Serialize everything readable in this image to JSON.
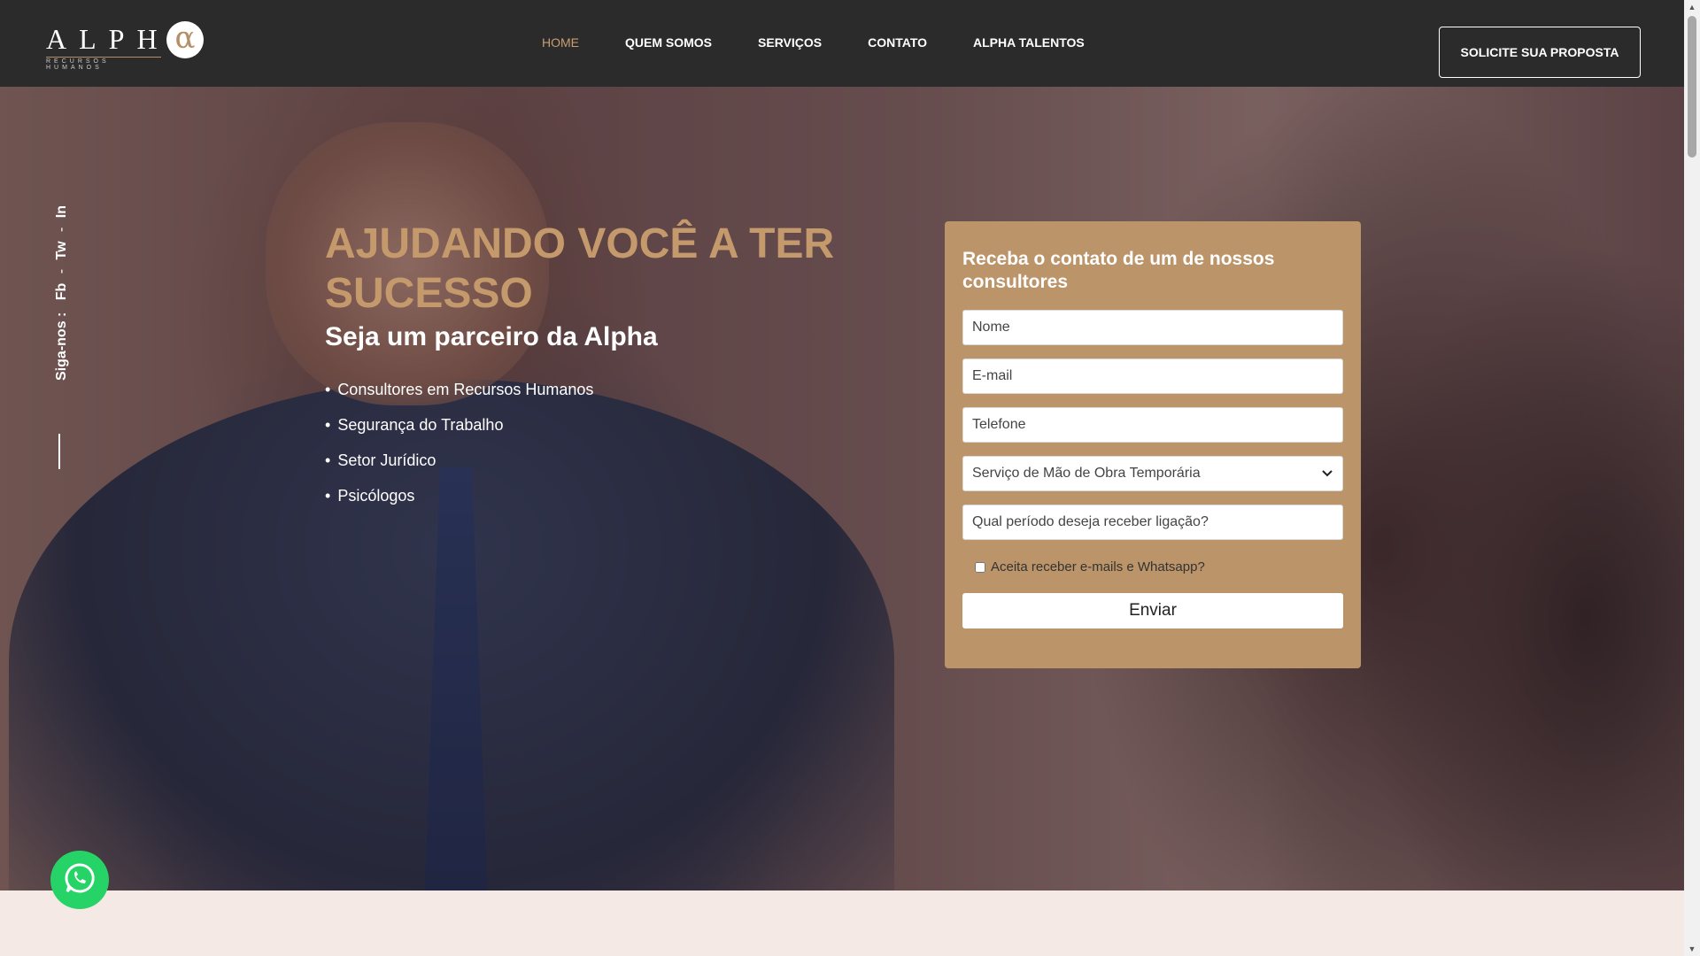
{
  "header": {
    "logo": {
      "word": "ALPH",
      "alpha": "α",
      "subtitle": "RECURSOS HUMANOS"
    },
    "nav": [
      {
        "label": "HOME",
        "active": true
      },
      {
        "label": "QUEM SOMOS"
      },
      {
        "label": "SERVIÇOS"
      },
      {
        "label": "CONTATO"
      },
      {
        "label": "ALPHA TALENTOS"
      }
    ],
    "cta_label": "SOLICITE SUA PROPOSTA"
  },
  "social": {
    "label": "Siga-nos :",
    "links": [
      "Fb",
      "Tw",
      "In"
    ],
    "separator": "-"
  },
  "hero": {
    "headline": "AJUDANDO VOCÊ A TER SUCESSO",
    "subhead": "Seja um parceiro da Alpha",
    "bullets": [
      "Consultores em Recursos Humanos",
      "Segurança do Trabalho",
      "Setor Jurídico",
      "Psicólogos"
    ]
  },
  "form": {
    "title": "Receba o contato de um de nossos consultores",
    "name_placeholder": "Nome",
    "email_placeholder": "E-mail",
    "phone_placeholder": "Telefone",
    "service_selected": "Serviço de Mão de Obra Temporária",
    "period_placeholder": "Qual período deseja receber ligação?",
    "consent_label": "Aceita receber e-mails e Whatsapp?",
    "submit_label": "Enviar"
  },
  "colors": {
    "header_bg": "#2b2b2b",
    "accent": "#c49a6c",
    "form_bg": "#bc9469",
    "whatsapp": "#25d366",
    "page_bg": "#f5e9e5"
  },
  "icons": {
    "whatsapp": "whatsapp-icon",
    "select": "chevron-down-icon"
  }
}
